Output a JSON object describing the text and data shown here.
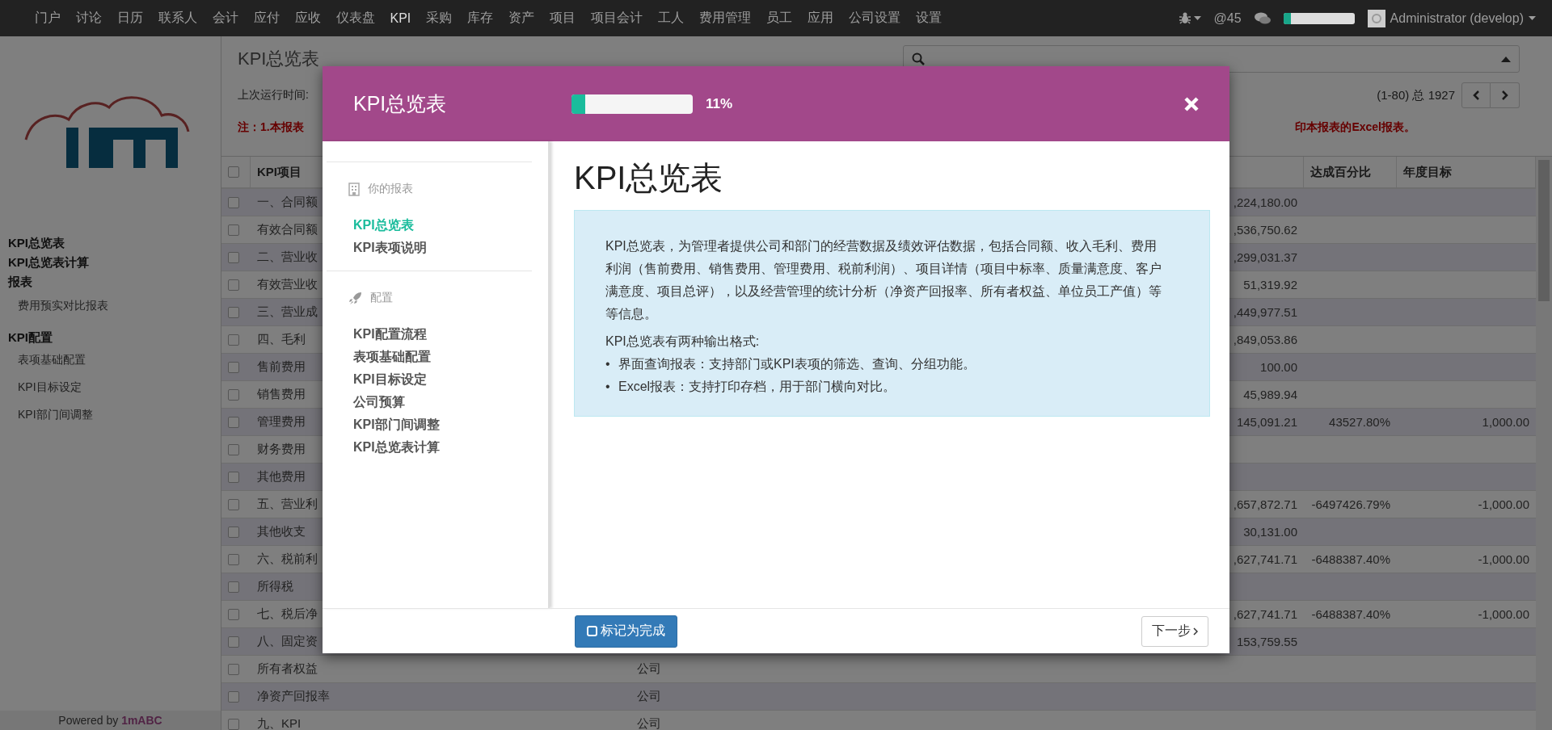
{
  "top_nav": {
    "items": [
      {
        "label": "门户",
        "selected": false
      },
      {
        "label": "讨论",
        "selected": false
      },
      {
        "label": "日历",
        "selected": false
      },
      {
        "label": "联系人",
        "selected": false
      },
      {
        "label": "会计",
        "selected": false
      },
      {
        "label": "应付",
        "selected": false
      },
      {
        "label": "应收",
        "selected": false
      },
      {
        "label": "仪表盘",
        "selected": false
      },
      {
        "label": "KPI",
        "selected": true
      },
      {
        "label": "采购",
        "selected": false
      },
      {
        "label": "库存",
        "selected": false
      },
      {
        "label": "资产",
        "selected": false
      },
      {
        "label": "项目",
        "selected": false
      },
      {
        "label": "项目会计",
        "selected": false
      },
      {
        "label": "工人",
        "selected": false
      },
      {
        "label": "费用管理",
        "selected": false
      },
      {
        "label": "员工",
        "selected": false
      },
      {
        "label": "应用",
        "selected": false
      },
      {
        "label": "公司设置",
        "selected": false
      },
      {
        "label": "设置",
        "selected": false
      }
    ],
    "mentions": "@45",
    "progress": {
      "level": 0.11
    },
    "user": "Administrator (develop)"
  },
  "sidebar": {
    "items": [
      {
        "label": "KPI总览表",
        "kind": "heading"
      },
      {
        "label": "KPI总览表计算",
        "kind": "heading"
      },
      {
        "label": "报表",
        "kind": "heading"
      },
      {
        "label": "费用预实对比报表",
        "kind": "link"
      },
      {
        "label": "KPI配置",
        "kind": "section"
      },
      {
        "label": "表项基础配置",
        "kind": "link"
      },
      {
        "label": "KPI目标设定",
        "kind": "link"
      },
      {
        "label": "KPI部门间调整",
        "kind": "link"
      }
    ],
    "footer": "Powered by **1mABC**"
  },
  "page": {
    "title": "KPI总览表",
    "last_run": "上次运行时间:",
    "note_left": "注：1.本报表",
    "note_right": "印本报表的Excel报表。",
    "pagination": "(1-80) 总 1927"
  },
  "table": {
    "header_checked": false,
    "columns": [
      "KPI项目",
      "达成百分比",
      "年度目标"
    ],
    "rows": [
      {
        "item": "一、合同额",
        "checked": false,
        "value": ",224,180.00"
      },
      {
        "item": "有效合同额",
        "checked": false,
        "value": ",536,750.62"
      },
      {
        "item": "二、营业收",
        "checked": false,
        "value": ",299,031.37"
      },
      {
        "item": "有效营业收",
        "checked": false,
        "value": "51,319.92"
      },
      {
        "item": "三、营业成",
        "checked": false,
        "value": ",449,977.51"
      },
      {
        "item": "四、毛利",
        "checked": false,
        "value": ",849,053.86"
      },
      {
        "item": "售前费用",
        "checked": false,
        "value": "100.00"
      },
      {
        "item": "销售费用",
        "checked": false,
        "value": "45,989.94"
      },
      {
        "item": "管理费用",
        "checked": false,
        "value": "145,091.21",
        "percent": "43527.80%",
        "target": "1,000.00"
      },
      {
        "item": "财务费用",
        "checked": false
      },
      {
        "item": "其他费用",
        "checked": false
      },
      {
        "item": "五、营业利",
        "checked": false,
        "value": ",657,872.71",
        "percent": "-6497426.79%",
        "target": "-1,000.00"
      },
      {
        "item": "其他收支",
        "checked": false,
        "value": "30,131.00"
      },
      {
        "item": "六、税前利",
        "checked": false,
        "value": ",627,741.71",
        "percent": "-6488387.40%",
        "target": "-1,000.00"
      },
      {
        "item": "所得税",
        "checked": false
      },
      {
        "item": "七、税后净",
        "checked": false,
        "value": ",627,741.71",
        "percent": "-6488387.40%",
        "target": "-1,000.00"
      },
      {
        "item": "八、固定资",
        "checked": false,
        "value": "153,759.55"
      },
      {
        "item": "所有者权益",
        "checked": false,
        "entity": "公司"
      },
      {
        "item": "净资产回报率",
        "checked": false,
        "entity": "公司"
      },
      {
        "item": "九、KPI",
        "checked": false,
        "entity": "公司"
      }
    ]
  },
  "modal": {
    "title": "KPI总览表",
    "progress": {
      "level": 0.11,
      "label": "11%"
    },
    "nav": [
      {
        "heading": "你的报表",
        "kind": "reports",
        "items": [
          {
            "label": "KPI总览表",
            "selected": true
          },
          {
            "label": "KPI表项说明",
            "selected": false
          }
        ]
      },
      {
        "heading": "配置",
        "kind": "config",
        "items": [
          {
            "label": "KPI配置流程",
            "selected": false
          },
          {
            "label": "表项基础配置",
            "selected": false
          },
          {
            "label": "KPI目标设定",
            "selected": false
          },
          {
            "label": "公司预算",
            "selected": false
          },
          {
            "label": "KPI部门间调整",
            "selected": false
          },
          {
            "label": "KPI总览表计算",
            "selected": false
          }
        ]
      }
    ],
    "heading": "KPI总览表",
    "info": {
      "paragraph": "KPI总览表，为管理者提供公司和部门的经营数据及绩效评估数据，包括合同额、收入毛利、费用利润（售前费用、销售费用、管理费用、税前利润）、项目详情（项目中标率、质量满意度、客户满意度、项目总评），以及经营管理的统计分析（净资产回报率、所有者权益、单位员工产值）等等信息。",
      "subtitle": "KPI总览表有两种输出格式:",
      "bullets": [
        {
          "marker": "•",
          "text": "界面查询报表：支持部门或KPI表项的筛选、查询、分组功能。"
        },
        {
          "marker": "•",
          "text": "Excel报表：支持打印存档，用于部门横向对比。"
        }
      ]
    },
    "complete_button": "标记为完成",
    "next_button": "下一步"
  }
}
